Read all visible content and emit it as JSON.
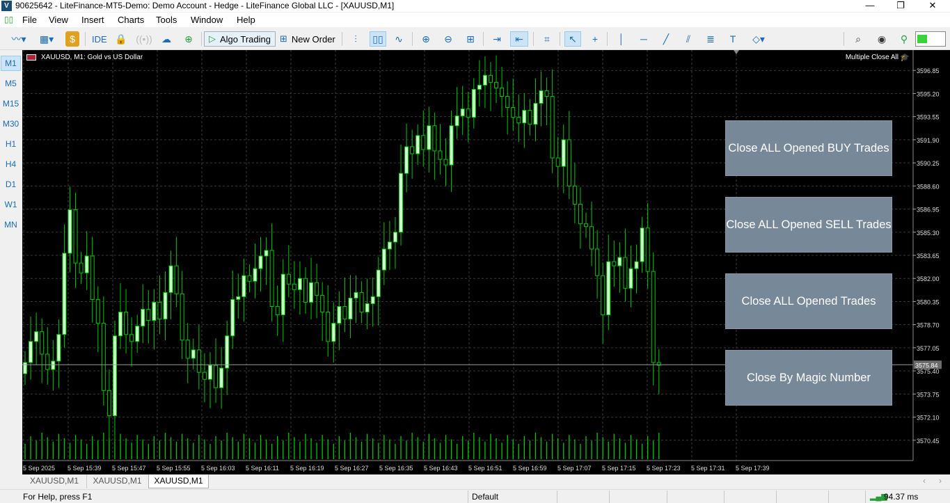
{
  "window": {
    "title": "90625642 - LiteFinance-MT5-Demo: Demo Account - Hedge - LiteFinance Global LLC - [XAUUSD,M1]",
    "minimize": "—",
    "restore": "❐",
    "close": "✕"
  },
  "menu": [
    "File",
    "View",
    "Insert",
    "Charts",
    "Tools",
    "Window",
    "Help"
  ],
  "toolbar": {
    "ide": "IDE",
    "algo_trading": "Algo Trading",
    "new_order": "New Order"
  },
  "timeframes": [
    "M1",
    "M5",
    "M15",
    "M30",
    "H1",
    "H4",
    "D1",
    "W1",
    "MN"
  ],
  "chart": {
    "symbol_label": "XAUUSD, M1:  Gold vs US Dollar",
    "ea_label": "Multiple Close All",
    "current_price": "3575.84",
    "buttons": {
      "close_buy": "Close ALL Opened BUY Trades",
      "close_sell": "Close ALL Opened SELL Trades",
      "close_all": "Close ALL Opened Trades",
      "close_magic": "Close By Magic Number"
    },
    "colors": {
      "background": "#000000",
      "bull": "#ccffcc",
      "bear": "#000000",
      "wick": "#00c800",
      "grid": "#3a3a3a",
      "volume": "#00c800",
      "button": "#778899"
    }
  },
  "chart_data": {
    "type": "candlestick",
    "price_ticks": [
      "3596.85",
      "3595.20",
      "3593.55",
      "3591.90",
      "3590.25",
      "3588.60",
      "3586.95",
      "3585.30",
      "3583.65",
      "3582.00",
      "3580.35",
      "3578.70",
      "3577.05",
      "3575.40",
      "3573.75",
      "3572.10",
      "3570.45"
    ],
    "time_ticks": [
      "5 Sep 2025",
      "5 Sep 15:39",
      "5 Sep 15:47",
      "5 Sep 15:55",
      "5 Sep 16:03",
      "5 Sep 16:11",
      "5 Sep 16:19",
      "5 Sep 16:27",
      "5 Sep 16:35",
      "5 Sep 16:43",
      "5 Sep 16:51",
      "5 Sep 16:59",
      "5 Sep 17:07",
      "5 Sep 17:15",
      "5 Sep 17:23",
      "5 Sep 17:31",
      "5 Sep 17:39"
    ],
    "closes": [
      3576.0,
      3577.5,
      3578.2,
      3576.6,
      3575.5,
      3576.1,
      3578.0,
      3583.8,
      3586.9,
      3583.1,
      3582.4,
      3583.6,
      3580.5,
      3578.8,
      3574.0,
      3572.2,
      3577.9,
      3579.6,
      3578.0,
      3577.5,
      3578.6,
      3579.8,
      3579.0,
      3580.3,
      3579.1,
      3581.0,
      3582.9,
      3580.9,
      3577.6,
      3576.3,
      3576.9,
      3575.3,
      3574.8,
      3575.8,
      3574.2,
      3575.6,
      3577.9,
      3580.5,
      3580.7,
      3582.2,
      3581.8,
      3582.7,
      3583.6,
      3584.0,
      3580.0,
      3579.4,
      3582.3,
      3581.6,
      3581.2,
      3582.0,
      3580.3,
      3581.7,
      3580.8,
      3579.6,
      3577.5,
      3578.8,
      3580.0,
      3579.1,
      3580.6,
      3581.0,
      3579.6,
      3580.2,
      3580.7,
      3582.6,
      3584.1,
      3584.6,
      3585.3,
      3589.5,
      3591.4,
      3590.9,
      3592.2,
      3591.2,
      3592.9,
      3591.1,
      3590.5,
      3590.1,
      3592.9,
      3593.6,
      3594.1,
      3593.5,
      3595.5,
      3595.8,
      3596.5,
      3596.0,
      3595.6,
      3595.0,
      3594.2,
      3593.5,
      3593.1,
      3594.0,
      3593.0,
      3594.5,
      3595.4,
      3595.0,
      3590.6,
      3590.0,
      3591.9,
      3588.6,
      3587.3,
      3585.9,
      3585.7,
      3584.1,
      3582.2,
      3579.4,
      3583.2,
      3582.9,
      3583.5,
      3581.3,
      3582.7,
      3583.2,
      3585.6,
      3582.5,
      3576.0,
      3575.8
    ]
  },
  "tabs": [
    "XAUUSD,M1",
    "XAUUSD,M1",
    "XAUUSD,M1"
  ],
  "status": {
    "help": "For Help, press F1",
    "profile": "Default",
    "ping": "94.37 ms"
  }
}
